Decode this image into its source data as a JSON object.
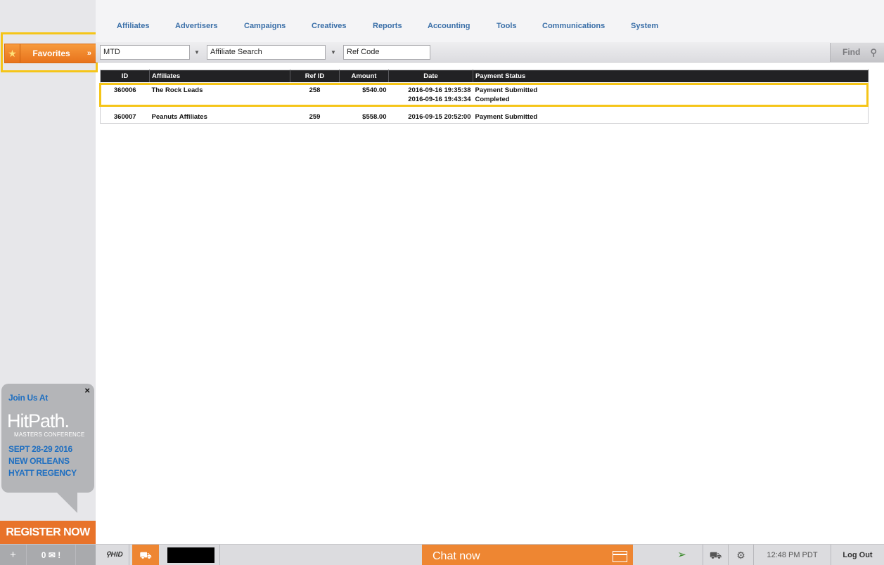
{
  "sidebar": {
    "favorites_label": "Favorites",
    "favorites_arrows": "»"
  },
  "promo": {
    "close": "×",
    "join": "Join Us At",
    "logo": "HitPath.",
    "sub": "MASTERS CONFERENCE",
    "line1": "SEPT 28-29 2016",
    "line2": "NEW ORLEANS",
    "line3": "HYATT REGENCY",
    "register": "REGISTER NOW"
  },
  "nav": {
    "items": [
      "Affiliates",
      "Advertisers",
      "Campaigns",
      "Creatives",
      "Reports",
      "Accounting",
      "Tools",
      "Communications",
      "System"
    ]
  },
  "filters": {
    "period": "MTD",
    "affiliate_search": "Affiliate Search",
    "ref_code": "Ref Code",
    "find_label": "Find"
  },
  "table": {
    "headers": [
      "ID",
      "Affiliates",
      "Ref ID",
      "Amount",
      "Date",
      "Payment Status"
    ],
    "rows": [
      {
        "id": "360006",
        "affiliate": "The Rock Leads",
        "ref_id": "258",
        "amount": "$540.00",
        "date1": "2016-09-16 19:35:38",
        "date2": "2016-09-16 19:43:34",
        "status1": "Payment Submitted",
        "status2": "Completed"
      },
      {
        "id": "360007",
        "affiliate": "Peanuts Affiliates",
        "ref_id": "259",
        "amount": "$558.00",
        "date1": "2016-09-15 20:52:00",
        "status1": "Payment Submitted"
      }
    ]
  },
  "bottombar": {
    "plus": "+",
    "mail_count": "0",
    "mail_alert": "!",
    "hid_label": "HID",
    "chat_label": "Chat now",
    "time": "12:48 PM PDT",
    "logout": "Log Out"
  },
  "colors": {
    "accent_orange": "#ee8632",
    "highlight_yellow": "#f5c518",
    "nav_blue": "#3a6fa8",
    "header_dark": "#222224"
  }
}
